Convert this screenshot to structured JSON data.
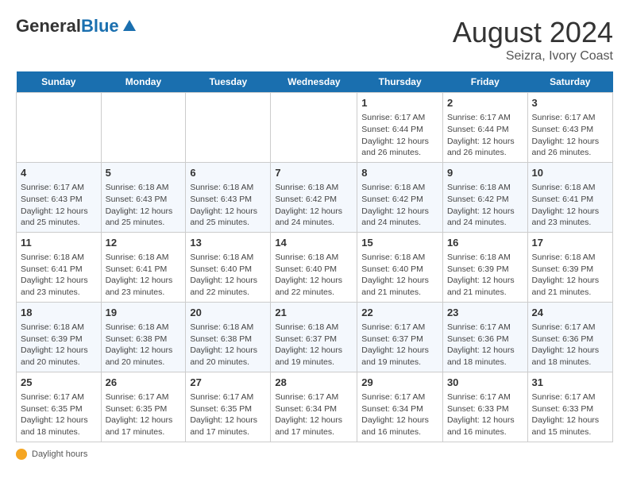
{
  "header": {
    "logo_general": "General",
    "logo_blue": "Blue",
    "main_title": "August 2024",
    "subtitle": "Seizra, Ivory Coast"
  },
  "days_of_week": [
    "Sunday",
    "Monday",
    "Tuesday",
    "Wednesday",
    "Thursday",
    "Friday",
    "Saturday"
  ],
  "weeks": [
    [
      {
        "day": "",
        "info": ""
      },
      {
        "day": "",
        "info": ""
      },
      {
        "day": "",
        "info": ""
      },
      {
        "day": "",
        "info": ""
      },
      {
        "day": "1",
        "info": "Sunrise: 6:17 AM\nSunset: 6:44 PM\nDaylight: 12 hours and 26 minutes."
      },
      {
        "day": "2",
        "info": "Sunrise: 6:17 AM\nSunset: 6:44 PM\nDaylight: 12 hours and 26 minutes."
      },
      {
        "day": "3",
        "info": "Sunrise: 6:17 AM\nSunset: 6:43 PM\nDaylight: 12 hours and 26 minutes."
      }
    ],
    [
      {
        "day": "4",
        "info": "Sunrise: 6:17 AM\nSunset: 6:43 PM\nDaylight: 12 hours and 25 minutes."
      },
      {
        "day": "5",
        "info": "Sunrise: 6:18 AM\nSunset: 6:43 PM\nDaylight: 12 hours and 25 minutes."
      },
      {
        "day": "6",
        "info": "Sunrise: 6:18 AM\nSunset: 6:43 PM\nDaylight: 12 hours and 25 minutes."
      },
      {
        "day": "7",
        "info": "Sunrise: 6:18 AM\nSunset: 6:42 PM\nDaylight: 12 hours and 24 minutes."
      },
      {
        "day": "8",
        "info": "Sunrise: 6:18 AM\nSunset: 6:42 PM\nDaylight: 12 hours and 24 minutes."
      },
      {
        "day": "9",
        "info": "Sunrise: 6:18 AM\nSunset: 6:42 PM\nDaylight: 12 hours and 24 minutes."
      },
      {
        "day": "10",
        "info": "Sunrise: 6:18 AM\nSunset: 6:41 PM\nDaylight: 12 hours and 23 minutes."
      }
    ],
    [
      {
        "day": "11",
        "info": "Sunrise: 6:18 AM\nSunset: 6:41 PM\nDaylight: 12 hours and 23 minutes."
      },
      {
        "day": "12",
        "info": "Sunrise: 6:18 AM\nSunset: 6:41 PM\nDaylight: 12 hours and 23 minutes."
      },
      {
        "day": "13",
        "info": "Sunrise: 6:18 AM\nSunset: 6:40 PM\nDaylight: 12 hours and 22 minutes."
      },
      {
        "day": "14",
        "info": "Sunrise: 6:18 AM\nSunset: 6:40 PM\nDaylight: 12 hours and 22 minutes."
      },
      {
        "day": "15",
        "info": "Sunrise: 6:18 AM\nSunset: 6:40 PM\nDaylight: 12 hours and 21 minutes."
      },
      {
        "day": "16",
        "info": "Sunrise: 6:18 AM\nSunset: 6:39 PM\nDaylight: 12 hours and 21 minutes."
      },
      {
        "day": "17",
        "info": "Sunrise: 6:18 AM\nSunset: 6:39 PM\nDaylight: 12 hours and 21 minutes."
      }
    ],
    [
      {
        "day": "18",
        "info": "Sunrise: 6:18 AM\nSunset: 6:39 PM\nDaylight: 12 hours and 20 minutes."
      },
      {
        "day": "19",
        "info": "Sunrise: 6:18 AM\nSunset: 6:38 PM\nDaylight: 12 hours and 20 minutes."
      },
      {
        "day": "20",
        "info": "Sunrise: 6:18 AM\nSunset: 6:38 PM\nDaylight: 12 hours and 20 minutes."
      },
      {
        "day": "21",
        "info": "Sunrise: 6:18 AM\nSunset: 6:37 PM\nDaylight: 12 hours and 19 minutes."
      },
      {
        "day": "22",
        "info": "Sunrise: 6:17 AM\nSunset: 6:37 PM\nDaylight: 12 hours and 19 minutes."
      },
      {
        "day": "23",
        "info": "Sunrise: 6:17 AM\nSunset: 6:36 PM\nDaylight: 12 hours and 18 minutes."
      },
      {
        "day": "24",
        "info": "Sunrise: 6:17 AM\nSunset: 6:36 PM\nDaylight: 12 hours and 18 minutes."
      }
    ],
    [
      {
        "day": "25",
        "info": "Sunrise: 6:17 AM\nSunset: 6:35 PM\nDaylight: 12 hours and 18 minutes."
      },
      {
        "day": "26",
        "info": "Sunrise: 6:17 AM\nSunset: 6:35 PM\nDaylight: 12 hours and 17 minutes."
      },
      {
        "day": "27",
        "info": "Sunrise: 6:17 AM\nSunset: 6:35 PM\nDaylight: 12 hours and 17 minutes."
      },
      {
        "day": "28",
        "info": "Sunrise: 6:17 AM\nSunset: 6:34 PM\nDaylight: 12 hours and 17 minutes."
      },
      {
        "day": "29",
        "info": "Sunrise: 6:17 AM\nSunset: 6:34 PM\nDaylight: 12 hours and 16 minutes."
      },
      {
        "day": "30",
        "info": "Sunrise: 6:17 AM\nSunset: 6:33 PM\nDaylight: 12 hours and 16 minutes."
      },
      {
        "day": "31",
        "info": "Sunrise: 6:17 AM\nSunset: 6:33 PM\nDaylight: 12 hours and 15 minutes."
      }
    ]
  ],
  "footer": {
    "daylight_label": "Daylight hours"
  }
}
